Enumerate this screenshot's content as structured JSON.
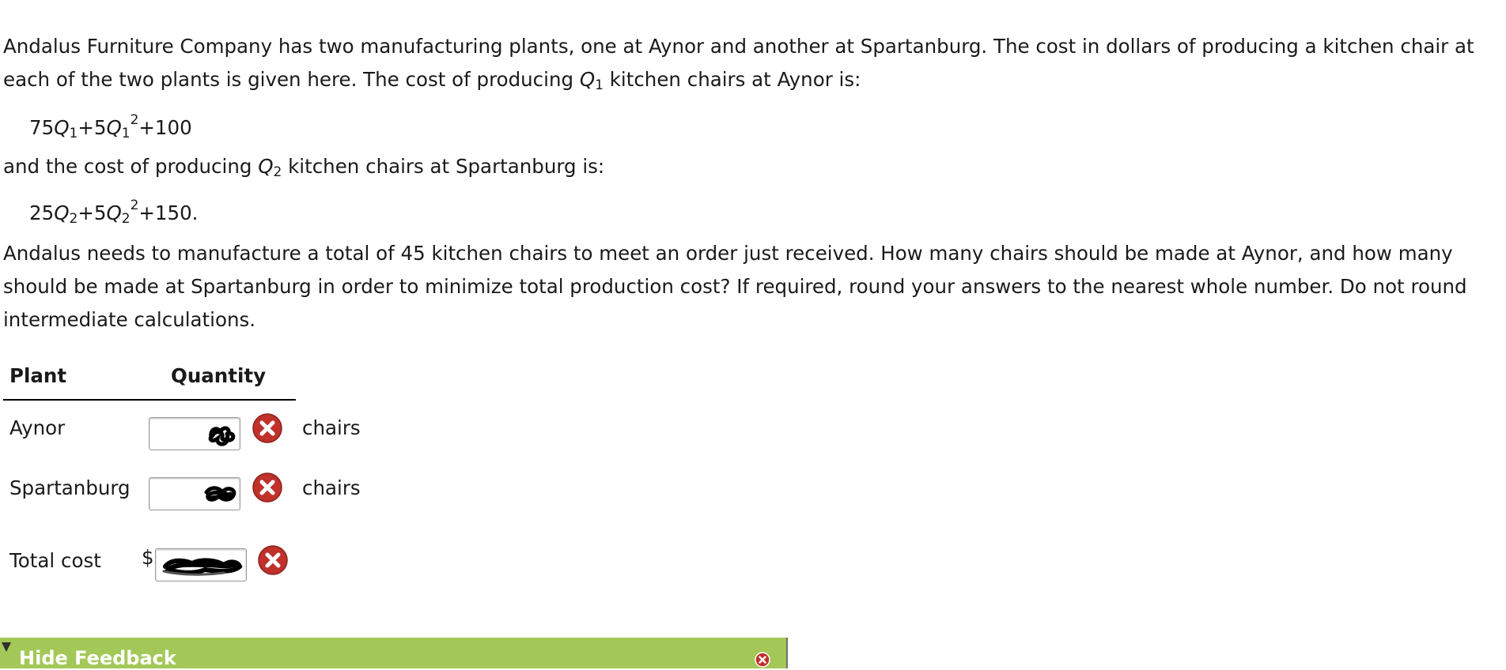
{
  "problem": {
    "intro_line1": "Andalus Furniture Company has two manufacturing plants, one at Aynor and another at Spartanburg. The cost in dollars of producing a kitchen chair at",
    "intro_line2_a": "each of the two plants is given here. The cost of producing ",
    "intro_line2_var": "Q",
    "intro_line2_sub": "1",
    "intro_line2_b": " kitchen chairs at Aynor is:",
    "formula1": {
      "c1": "75",
      "v1": "Q",
      "s1": "1",
      "plus1": "+5",
      "v2": "Q",
      "s2": "1",
      "exp": "2",
      "tail": "+100"
    },
    "mid_a": "and the cost of producing ",
    "mid_var": "Q",
    "mid_sub": "2",
    "mid_b": " kitchen chairs at Spartanburg is:",
    "formula2": {
      "c1": "25",
      "v1": "Q",
      "s1": "2",
      "plus1": "+5",
      "v2": "Q",
      "s2": "2",
      "exp": "2",
      "tail": "+150."
    },
    "question_line1": "Andalus needs to manufacture a total of 45 kitchen chairs to meet an order just received. How many chairs should be made at Aynor, and how many",
    "question_line2": "should be made at Spartanburg in order to minimize total production cost? If required, round your answers to the nearest whole number. Do not round",
    "question_line3": "intermediate calculations."
  },
  "table": {
    "col_plant": "Plant",
    "col_quantity": "Quantity",
    "rows": [
      {
        "label": "Aynor",
        "unit": "chairs",
        "status": "incorrect"
      },
      {
        "label": "Spartanburg",
        "unit": "chairs",
        "status": "incorrect"
      }
    ],
    "total": {
      "label": "Total cost",
      "currency": "$",
      "status": "incorrect"
    }
  },
  "feedback": {
    "label": "Hide Feedback",
    "toggle_icon": "triangle-down-icon",
    "close_icon": "close-icon"
  },
  "colors": {
    "error_red": "#c0312b",
    "feedback_green": "#a3c857",
    "text": "#1a1a1a"
  }
}
